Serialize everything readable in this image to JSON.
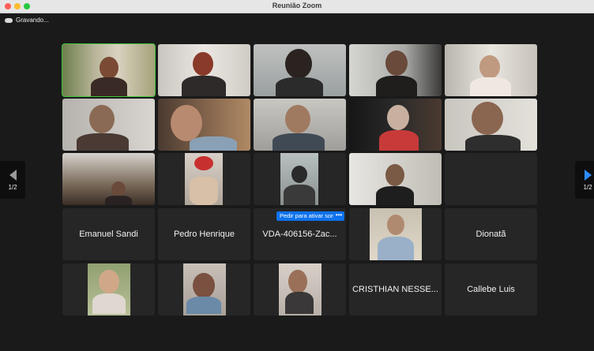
{
  "window": {
    "title": "Reunião Zoom"
  },
  "recording": {
    "label": "Gravando...",
    "icon": "cloud-recording-icon"
  },
  "pagination": {
    "left_label": "1/2",
    "right_label": "1/2"
  },
  "unmute_request": {
    "label": "Pedir para ativar som",
    "more_label": "•••"
  },
  "participants": [
    {
      "name": "Emanuel Sandi"
    },
    {
      "name": "Pedro Henrique"
    },
    {
      "name": "VDA-406156-Zac..."
    },
    {
      "name": "Dionatã"
    },
    {
      "name": "CRISTHIAN NESSE..."
    },
    {
      "name": "Callebe Luis"
    }
  ],
  "colors": {
    "active_speaker": "#3cc43c",
    "accent": "#0e72ed",
    "background": "#1a1a1a"
  }
}
